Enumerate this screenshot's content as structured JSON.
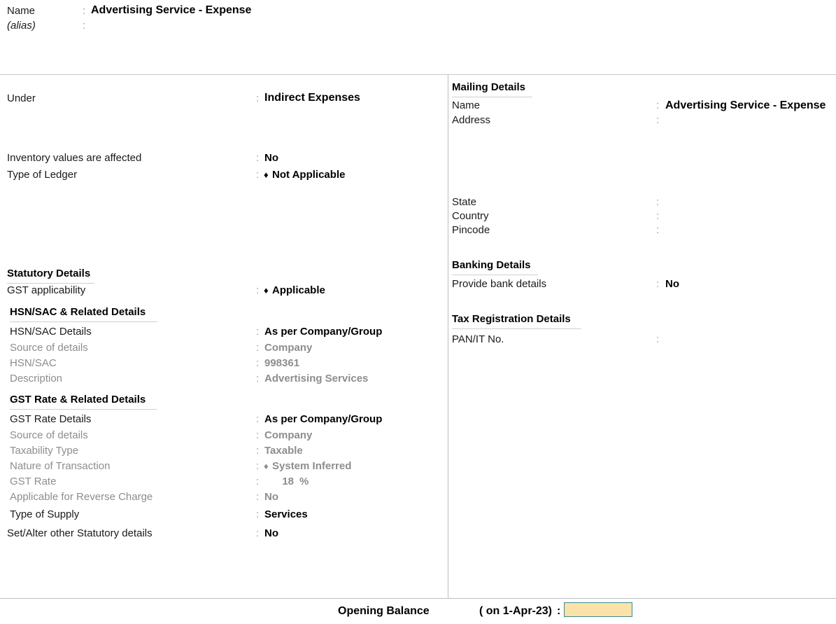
{
  "header": {
    "name_label": "Name",
    "name_colon": ":",
    "name_value": "Advertising Service - Expense",
    "alias_label": "(alias)",
    "alias_colon": ":",
    "alias_value": ""
  },
  "left_panel": {
    "under_label": "Under",
    "under_colon": ":",
    "under_value": "Indirect Expenses",
    "inventory_label": "Inventory values are affected",
    "inventory_colon": ":",
    "inventory_value": "No",
    "ledger_type_label": "Type of Ledger",
    "ledger_type_colon": ":",
    "ledger_type_marker": "♦",
    "ledger_type_value": "Not Applicable",
    "statutory_heading": "Statutory Details",
    "gst_applicability_label": "GST applicability",
    "gst_applicability_colon": ":",
    "gst_applicability_marker": "♦",
    "gst_applicability_value": "Applicable",
    "hsn_heading": "HSN/SAC & Related Details",
    "hsn_rows": [
      {
        "label": "HSN/SAC Details",
        "colon": ":",
        "value": "As per Company/Group",
        "dim": false
      },
      {
        "label": "Source of details",
        "colon": ":",
        "value": "Company",
        "dim": true
      },
      {
        "label": "HSN/SAC",
        "colon": ":",
        "value": "998361",
        "dim": true
      },
      {
        "label": "Description",
        "colon": ":",
        "value": "Advertising Services",
        "dim": true
      }
    ],
    "gst_rate_heading": "GST Rate & Related Details",
    "gst_rate_rows": [
      {
        "label": "GST Rate Details",
        "colon": ":",
        "value": "As per Company/Group",
        "dim": false
      },
      {
        "label": "Source of details",
        "colon": ":",
        "value": "Company",
        "dim": true
      },
      {
        "label": "Taxability Type",
        "colon": ":",
        "value": "Taxable",
        "dim": true
      }
    ],
    "nature_label": "Nature of Transaction",
    "nature_colon": ":",
    "nature_marker": "♦",
    "nature_value": "System Inferred",
    "gst_rate_label": "GST Rate",
    "gst_rate_colon": ":",
    "gst_rate_number": "18",
    "gst_rate_unit": "%",
    "reverse_charge_label": "Applicable for Reverse Charge",
    "reverse_charge_colon": ":",
    "reverse_charge_value": "No",
    "type_of_supply_label": "Type of Supply",
    "type_of_supply_colon": ":",
    "type_of_supply_value": "Services",
    "set_alter_label": "Set/Alter other Statutory details",
    "set_alter_colon": ":",
    "set_alter_value": "No"
  },
  "right_panel": {
    "mailing_heading": "Mailing Details",
    "mailing_name_label": "Name",
    "mailing_name_colon": ":",
    "mailing_name_value": "Advertising Service - Expense",
    "mailing_address_label": "Address",
    "mailing_address_colon": ":",
    "mailing_address_value": "",
    "state_label": "State",
    "state_colon": ":",
    "state_value": "",
    "country_label": "Country",
    "country_colon": ":",
    "country_value": "",
    "pincode_label": "Pincode",
    "pincode_colon": ":",
    "pincode_value": "",
    "banking_heading": "Banking Details",
    "provide_bank_label": "Provide bank details",
    "provide_bank_colon": ":",
    "provide_bank_value": "No",
    "tax_reg_heading": "Tax Registration Details",
    "pan_label": "PAN/IT No.",
    "pan_colon": ":",
    "pan_value": ""
  },
  "footer": {
    "opening_balance_label": "Opening Balance",
    "opening_balance_date": "( on 1-Apr-23)",
    "opening_balance_colon": ":",
    "opening_balance_value": ""
  },
  "colors": {
    "input_fill": "#fbe2a8",
    "input_border": "#3a8b96",
    "dim_text": "#8d8d8d",
    "rule": "#bdbdbd"
  }
}
